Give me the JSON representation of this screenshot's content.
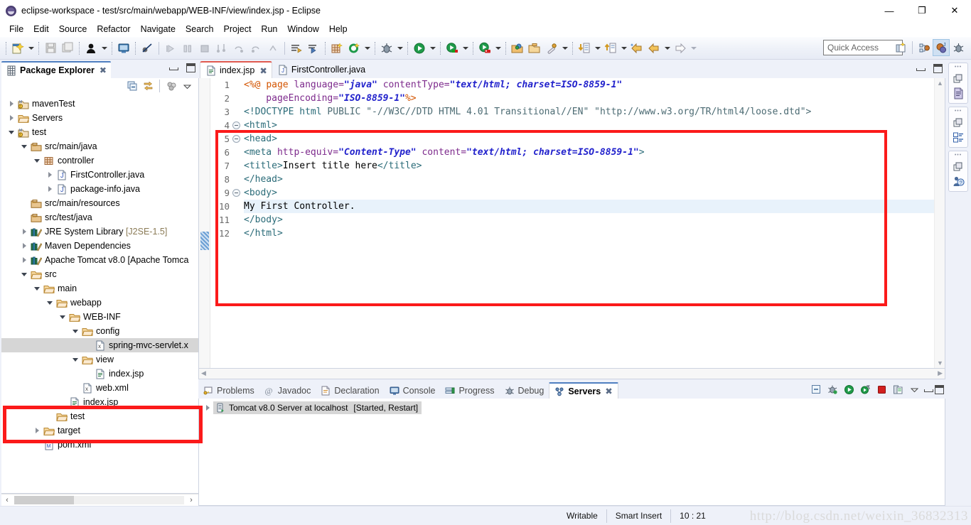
{
  "window": {
    "title": "eclipse-workspace - test/src/main/webapp/WEB-INF/view/index.jsp - Eclipse",
    "app_icon": "eclipse-icon",
    "minimize": "—",
    "maximize": "❐",
    "close": "✕"
  },
  "menubar": [
    {
      "label": "File",
      "mnemonic": "F"
    },
    {
      "label": "Edit",
      "mnemonic": "E"
    },
    {
      "label": "Source",
      "mnemonic": "S"
    },
    {
      "label": "Refactor",
      "mnemonic": "t"
    },
    {
      "label": "Navigate",
      "mnemonic": "N"
    },
    {
      "label": "Search",
      "mnemonic": "a"
    },
    {
      "label": "Project",
      "mnemonic": "P"
    },
    {
      "label": "Run",
      "mnemonic": "R"
    },
    {
      "label": "Window",
      "mnemonic": "W"
    },
    {
      "label": "Help",
      "mnemonic": "H"
    }
  ],
  "toolbar": {
    "quick_access_placeholder": "Quick Access",
    "buttons": [
      "new-wizard-icon",
      "save-icon",
      "save-all-icon",
      "java-toggle-icon",
      "new-console-icon",
      "skip-breakpoints-icon",
      "resume-icon",
      "suspend-icon",
      "terminate-icon",
      "step-into-icon",
      "step-over-icon",
      "step-return-icon",
      "step-drop-icon",
      "next-annotation-icon",
      "previous-annotation-icon",
      "new-java-package-icon",
      "new-java-class-icon",
      "debug-icon",
      "run-icon",
      "run-as-server-icon",
      "profile-icon",
      "open-type-icon",
      "open-task-icon",
      "search-icon",
      "previous-edit-icon",
      "next-edit-icon",
      "back-icon",
      "forward-icon"
    ],
    "perspective_buttons": [
      "open-perspective-icon",
      "java-ee-perspective-icon",
      "java-perspective-icon",
      "debug-perspective-icon"
    ]
  },
  "package_explorer": {
    "title": "Package Explorer",
    "close_glyph": "✖",
    "toolbar": [
      "collapse-all-icon",
      "link-with-editor-icon",
      "view-menu-filters-icon",
      "view-menu-icon"
    ],
    "tree": [
      {
        "label": "mavenTest",
        "depth": 0,
        "twist": "collapsed",
        "icon": "maven-project-icon"
      },
      {
        "label": "Servers",
        "depth": 0,
        "twist": "collapsed",
        "icon": "folder-icon"
      },
      {
        "label": "test",
        "depth": 0,
        "twist": "expanded",
        "icon": "maven-project-icon"
      },
      {
        "label": "src/main/java",
        "depth": 1,
        "twist": "expanded",
        "icon": "source-folder-icon"
      },
      {
        "label": "controller",
        "depth": 2,
        "twist": "expanded",
        "icon": "package-icon"
      },
      {
        "label": "FirstController.java",
        "depth": 3,
        "twist": "collapsed",
        "icon": "java-file-icon"
      },
      {
        "label": "package-info.java",
        "depth": 3,
        "twist": "collapsed",
        "icon": "java-file-icon"
      },
      {
        "label": "src/main/resources",
        "depth": 1,
        "twist": "none",
        "icon": "source-folder-icon"
      },
      {
        "label": "src/test/java",
        "depth": 1,
        "twist": "none",
        "icon": "source-folder-icon"
      },
      {
        "label": "JRE System Library",
        "suffix": "[J2SE-1.5]",
        "depth": 1,
        "twist": "collapsed",
        "icon": "library-icon"
      },
      {
        "label": "Maven Dependencies",
        "depth": 1,
        "twist": "collapsed",
        "icon": "library-icon"
      },
      {
        "label": "Apache Tomcat v8.0 [Apache Tomca",
        "depth": 1,
        "twist": "collapsed",
        "icon": "library-icon"
      },
      {
        "label": "src",
        "depth": 1,
        "twist": "expanded",
        "icon": "folder-icon"
      },
      {
        "label": "main",
        "depth": 2,
        "twist": "expanded",
        "icon": "folder-icon"
      },
      {
        "label": "webapp",
        "depth": 3,
        "twist": "expanded",
        "icon": "folder-icon"
      },
      {
        "label": "WEB-INF",
        "depth": 4,
        "twist": "expanded",
        "icon": "folder-icon"
      },
      {
        "label": "config",
        "depth": 5,
        "twist": "expanded",
        "icon": "folder-icon"
      },
      {
        "label": "spring-mvc-servlet.x",
        "depth": 6,
        "twist": "none",
        "icon": "xml-file-icon",
        "selected": true
      },
      {
        "label": "view",
        "depth": 5,
        "twist": "expanded",
        "icon": "folder-icon"
      },
      {
        "label": "index.jsp",
        "depth": 6,
        "twist": "none",
        "icon": "jsp-file-icon"
      },
      {
        "label": "web.xml",
        "depth": 5,
        "twist": "none",
        "icon": "xml-file-icon"
      },
      {
        "label": "index.jsp",
        "depth": 4,
        "twist": "none",
        "icon": "jsp-file-icon"
      },
      {
        "label": "test",
        "depth": 3,
        "twist": "none",
        "icon": "folder-icon"
      },
      {
        "label": "target",
        "depth": 2,
        "twist": "collapsed",
        "icon": "folder-icon"
      },
      {
        "label": "pom.xml",
        "depth": 2,
        "twist": "none",
        "icon": "maven-pom-icon"
      }
    ],
    "hscroll": {
      "left_arrow": "‹",
      "right_arrow": "›"
    }
  },
  "editor": {
    "tabs": [
      {
        "label": "index.jsp",
        "icon": "jsp-file-icon",
        "active": true,
        "close_glyph": "✖"
      },
      {
        "label": "FirstController.java",
        "icon": "java-file-icon",
        "active": false
      }
    ],
    "current_line": 10,
    "lines": [
      {
        "n": 1,
        "fold": false,
        "segments": [
          {
            "t": "<%@ ",
            "c": "k-dir"
          },
          {
            "t": "page ",
            "c": "k-dir"
          },
          {
            "t": "language=",
            "c": "k-attr"
          },
          {
            "t": "\"java\" ",
            "c": "k-str"
          },
          {
            "t": "contentType=",
            "c": "k-attr"
          },
          {
            "t": "\"text/html; charset=ISO-8859-1\"",
            "c": "k-str"
          }
        ]
      },
      {
        "n": 2,
        "fold": false,
        "segments": [
          {
            "t": "    pageEncoding=",
            "c": "k-attr"
          },
          {
            "t": "\"ISO-8859-1\"",
            "c": "k-str"
          },
          {
            "t": "%>",
            "c": "k-dir"
          }
        ]
      },
      {
        "n": 3,
        "fold": false,
        "segments": [
          {
            "t": "<!DOCTYPE ",
            "c": "k-tag"
          },
          {
            "t": "html ",
            "c": "k-tag"
          },
          {
            "t": "PUBLIC ",
            "c": "k-doctype"
          },
          {
            "t": "\"-//W3C//DTD HTML 4.01 Transitional//EN\" ",
            "c": "k-doctype"
          },
          {
            "t": "\"http://www.w3.org/TR/html4/loose.dtd\">",
            "c": "k-doctype"
          }
        ]
      },
      {
        "n": 4,
        "fold": true,
        "segments": [
          {
            "t": "<html>",
            "c": "k-tag"
          }
        ]
      },
      {
        "n": 5,
        "fold": true,
        "segments": [
          {
            "t": "<head>",
            "c": "k-tag"
          }
        ]
      },
      {
        "n": 6,
        "fold": false,
        "segments": [
          {
            "t": "<meta ",
            "c": "k-tag"
          },
          {
            "t": "http-equiv=",
            "c": "k-attr"
          },
          {
            "t": "\"Content-Type\" ",
            "c": "k-str"
          },
          {
            "t": "content=",
            "c": "k-attr"
          },
          {
            "t": "\"text/html; charset=ISO-8859-1\"",
            "c": "k-str"
          },
          {
            "t": ">",
            "c": "k-tag"
          }
        ]
      },
      {
        "n": 7,
        "fold": false,
        "segments": [
          {
            "t": "<title>",
            "c": "k-tag"
          },
          {
            "t": "Insert title here",
            "c": "k-txt"
          },
          {
            "t": "</title>",
            "c": "k-tag"
          }
        ]
      },
      {
        "n": 8,
        "fold": false,
        "segments": [
          {
            "t": "</head>",
            "c": "k-tag"
          }
        ]
      },
      {
        "n": 9,
        "fold": true,
        "segments": [
          {
            "t": "<body>",
            "c": "k-tag"
          }
        ]
      },
      {
        "n": 10,
        "fold": false,
        "segments": [
          {
            "t": "My First Controller.",
            "c": "k-txt"
          }
        ]
      },
      {
        "n": 11,
        "fold": false,
        "segments": [
          {
            "t": "</body>",
            "c": "k-tag"
          }
        ]
      },
      {
        "n": 12,
        "fold": false,
        "segments": [
          {
            "t": "</html>",
            "c": "k-tag"
          }
        ]
      }
    ]
  },
  "bottom_view": {
    "tabs": [
      {
        "label": "Problems",
        "icon": "problems-icon",
        "active": false
      },
      {
        "label": "Javadoc",
        "icon": "javadoc-icon",
        "active": false
      },
      {
        "label": "Declaration",
        "icon": "declaration-icon",
        "active": false
      },
      {
        "label": "Console",
        "icon": "console-icon",
        "active": false
      },
      {
        "label": "Progress",
        "icon": "progress-icon",
        "active": false
      },
      {
        "label": "Debug",
        "icon": "debug-icon",
        "active": false
      },
      {
        "label": "Servers",
        "icon": "servers-icon",
        "active": true,
        "close_glyph": "✖"
      }
    ],
    "toolbar": [
      "collapse-all-icon",
      "debug-server-icon",
      "start-server-icon",
      "profile-server-icon",
      "stop-server-icon",
      "publish-icon",
      "view-menu-icon",
      "minimize-icon",
      "maximize-icon"
    ],
    "rows": [
      {
        "twist": "collapsed",
        "icon": "server-icon",
        "label": "Tomcat v8.0 Server at localhost",
        "status": "[Started, Restart]",
        "selected": true
      }
    ]
  },
  "right_rail": {
    "groups": [
      {
        "restore_icon": "restore-icon",
        "icon": "outline-icon"
      },
      {
        "restore_icon": "restore-icon",
        "icon": "task-list-icon"
      },
      {
        "restore_icon": "restore-icon",
        "icon": "snippets-icon"
      }
    ]
  },
  "statusbar": {
    "writable": "Writable",
    "insert_mode": "Smart Insert",
    "position": "10 : 21",
    "watermark": "http://blog.csdn.net/weixin_36832313"
  },
  "colors": {
    "accent_blue": "#4f7fc0",
    "tab_red": "#e05a4f",
    "highlight_red": "#fb1a1a",
    "selection_grey": "#d6d6d6",
    "current_line": "#e8f2fb"
  }
}
